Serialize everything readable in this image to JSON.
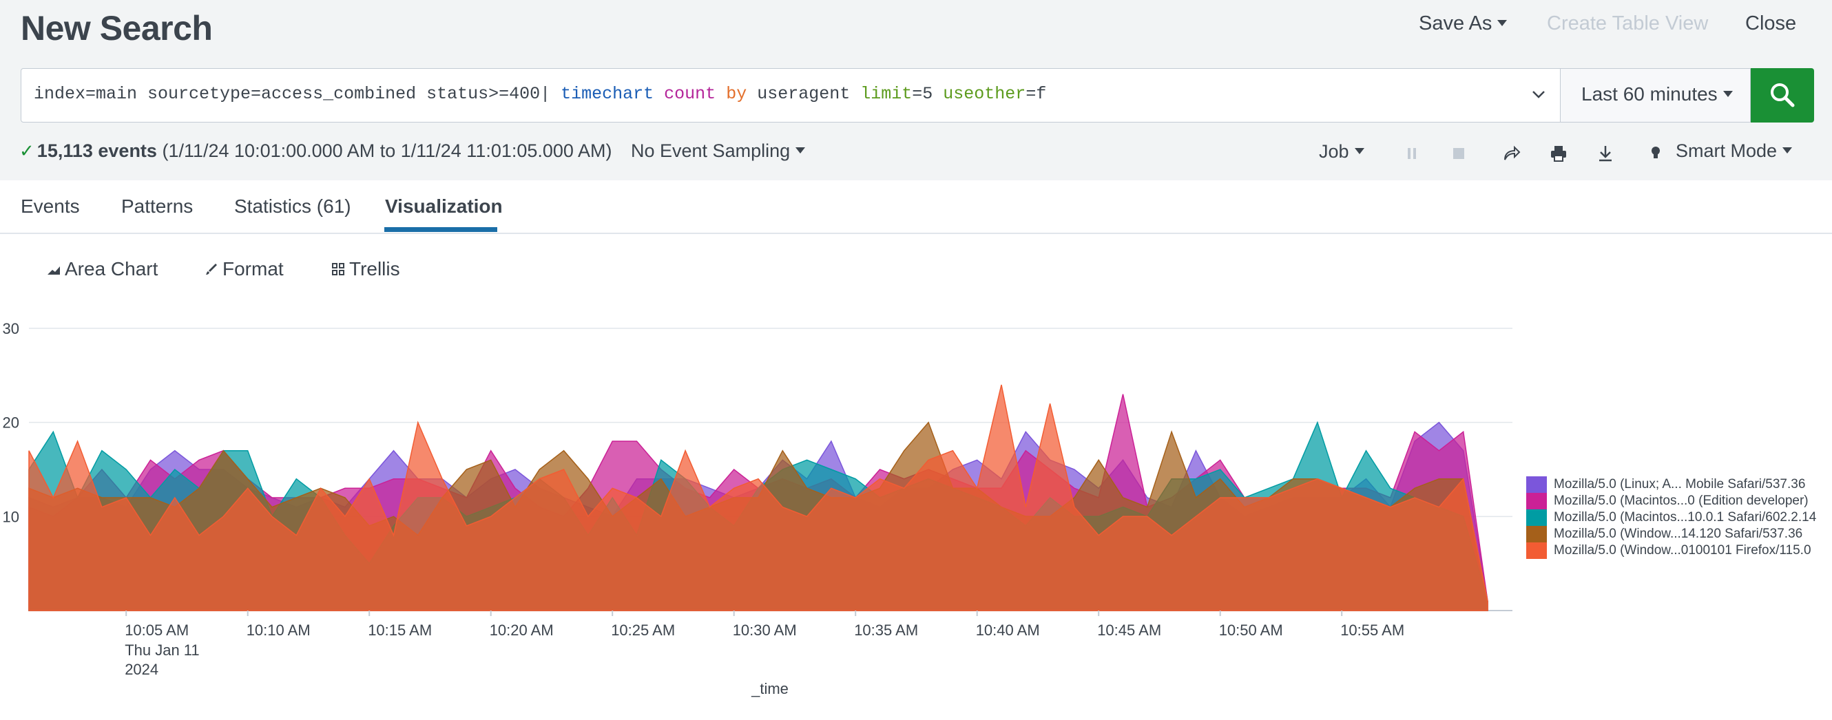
{
  "header": {
    "title": "New Search",
    "save_as_label": "Save As",
    "create_table_view_label": "Create Table View",
    "close_label": "Close"
  },
  "search": {
    "query_parts": {
      "base": "index=main sourcetype=access_combined status>=400| ",
      "cmd": "timechart",
      "sp1": " ",
      "fn": "count",
      "sp2": " ",
      "kw": "by",
      "field": " useragent ",
      "arg1": "limit",
      "val1": "=5 ",
      "arg2": "useother",
      "val2": "=f"
    },
    "time_range": "Last 60 minutes",
    "search_icon": "search-icon"
  },
  "status": {
    "event_count": "15,113 events",
    "time_span": "(1/11/24 10:01:00.000 AM to 1/11/24 11:01:05.000 AM)",
    "sampling": "No Event Sampling",
    "job_label": "Job",
    "mode": "Smart Mode"
  },
  "tabs": [
    {
      "label": "Events"
    },
    {
      "label": "Patterns"
    },
    {
      "label": "Statistics (61)"
    },
    {
      "label": "Visualization",
      "active": true
    }
  ],
  "viz_toolbar": {
    "chart_type_label": "Area Chart",
    "format_label": "Format",
    "trellis_label": "Trellis"
  },
  "colors": {
    "accent": "#1a6ea8",
    "search_button": "#1a9035"
  },
  "chart_data": {
    "type": "area",
    "xlabel": "_time",
    "ylim": [
      0,
      30
    ],
    "y_ticks": [
      "10",
      "20",
      "30"
    ],
    "x_tick_labels": [
      "10:05 AM",
      "10:10 AM",
      "10:15 AM",
      "10:20 AM",
      "10:25 AM",
      "10:30 AM",
      "10:35 AM",
      "10:40 AM",
      "10:45 AM",
      "10:50 AM",
      "10:55 AM"
    ],
    "x_tick_sublabel": [
      "Thu Jan 11",
      "2024"
    ],
    "grid": true,
    "legend_position": "right",
    "x_minutes": [
      1,
      2,
      3,
      4,
      5,
      6,
      7,
      8,
      9,
      10,
      11,
      12,
      13,
      14,
      15,
      16,
      17,
      18,
      19,
      20,
      21,
      22,
      23,
      24,
      25,
      26,
      27,
      28,
      29,
      30,
      31,
      32,
      33,
      34,
      35,
      36,
      37,
      38,
      39,
      40,
      41,
      42,
      43,
      44,
      45,
      46,
      47,
      48,
      49,
      50,
      51,
      52,
      53,
      54,
      55,
      56,
      57,
      58,
      59,
      60,
      61
    ],
    "series": [
      {
        "name": "Mozilla/5.0 (Linux; A... Mobile Safari/537.36",
        "color": "#7b56db",
        "values": [
          12,
          11,
          12,
          12,
          11,
          15,
          17,
          15,
          15,
          13,
          12,
          11,
          12,
          11,
          14,
          17,
          14,
          14,
          12,
          14,
          15,
          13,
          12,
          11,
          10,
          14,
          14,
          14,
          13,
          12,
          13,
          16,
          14,
          18,
          12,
          11,
          13,
          13,
          15,
          16,
          14,
          19,
          16,
          15,
          13,
          16,
          12,
          11,
          17,
          12,
          10,
          11,
          12,
          12,
          12,
          14,
          11,
          18,
          20,
          17,
          1
        ]
      },
      {
        "name": "Mozilla/5.0 (Macintos...0 (Edition developer)",
        "color": "#cb2196",
        "values": [
          11,
          10,
          12,
          15,
          12,
          16,
          14,
          16,
          17,
          14,
          12,
          12,
          12,
          13,
          13,
          14,
          14,
          13,
          12,
          17,
          13,
          11,
          10,
          13,
          18,
          18,
          15,
          13,
          12,
          15,
          13,
          14,
          13,
          14,
          12,
          15,
          14,
          15,
          14,
          13,
          13,
          17,
          15,
          13,
          12,
          23,
          11,
          12,
          14,
          16,
          12,
          12,
          13,
          14,
          13,
          13,
          12,
          19,
          17,
          19,
          1
        ]
      },
      {
        "name": "Mozilla/5.0 (Macintos...10.0.1 Safari/602.2.14",
        "color": "#009ca3",
        "values": [
          15,
          19,
          12,
          17,
          15,
          12,
          15,
          13,
          17,
          17,
          10,
          14,
          12,
          8,
          5,
          9,
          12,
          12,
          10,
          11,
          12,
          14,
          12,
          8,
          12,
          8,
          16,
          14,
          11,
          9,
          13,
          15,
          16,
          15,
          14,
          12,
          13,
          14,
          13,
          12,
          11,
          9,
          12,
          10,
          10,
          11,
          10,
          14,
          14,
          15,
          12,
          13,
          14,
          20,
          12,
          17,
          13,
          12,
          11,
          10,
          1
        ]
      },
      {
        "name": "Mozilla/5.0 (Window...14.120 Safari/537.36",
        "color": "#a5601a",
        "values": [
          13,
          12,
          13,
          12,
          12,
          12,
          11,
          13,
          17,
          14,
          11,
          12,
          13,
          12,
          9,
          10,
          8,
          12,
          15,
          16,
          11,
          15,
          17,
          14,
          10,
          12,
          14,
          10,
          11,
          12,
          12,
          17,
          13,
          12,
          12,
          13,
          17,
          20,
          13,
          13,
          11,
          10,
          10,
          12,
          16,
          12,
          11,
          19,
          12,
          14,
          11,
          12,
          14,
          14,
          13,
          12,
          11,
          13,
          14,
          14,
          1
        ]
      },
      {
        "name": "Mozilla/5.0 (Window...0100101 Firefox/115.0",
        "color": "#f25c33",
        "values": [
          17,
          12,
          18,
          11,
          12,
          8,
          12,
          8,
          10,
          13,
          10,
          8,
          13,
          10,
          14,
          8,
          20,
          14,
          9,
          10,
          12,
          14,
          15,
          10,
          13,
          12,
          10,
          17,
          11,
          13,
          14,
          11,
          10,
          13,
          12,
          14,
          13,
          16,
          17,
          13,
          24,
          11,
          22,
          11,
          8,
          10,
          10,
          8,
          10,
          12,
          12,
          12,
          13,
          14,
          13,
          12,
          11,
          12,
          11,
          14,
          1
        ]
      }
    ]
  }
}
